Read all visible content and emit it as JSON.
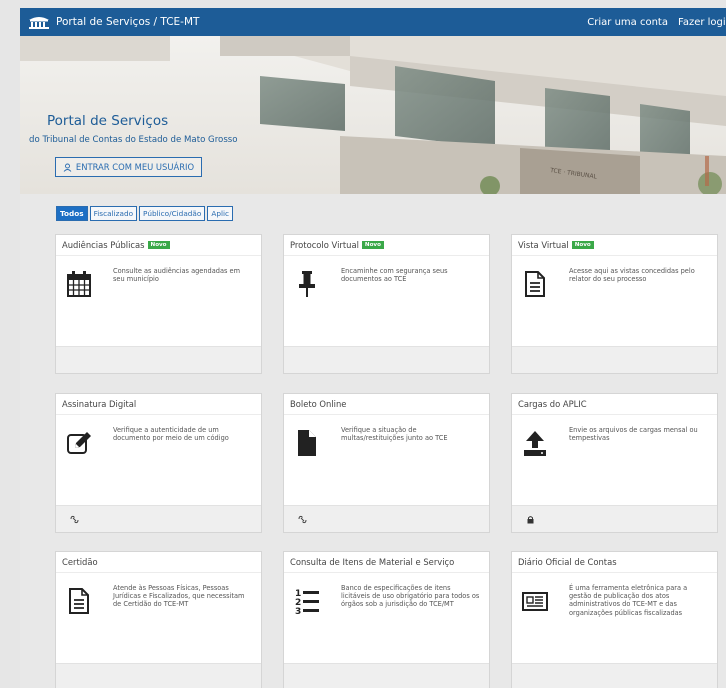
{
  "topbar": {
    "title": "Portal de Serviços / TCE-MT",
    "create_account": "Criar uma conta",
    "login": "Fazer login",
    "brand_color": "#1d5c97"
  },
  "hero": {
    "title": "Portal de Serviços",
    "subtitle": "do Tribunal de Contas do Estado de Mato Grosso",
    "login_button": "ENTRAR COM MEU USUÁRIO"
  },
  "tabs": [
    {
      "label": "Todos",
      "active": true
    },
    {
      "label": "Fiscalizado",
      "active": false
    },
    {
      "label": "Público/Cidadão",
      "active": false
    },
    {
      "label": "Aplic",
      "active": false
    }
  ],
  "badge_label": "Novo",
  "cards": [
    {
      "title": "Audiências Públicas",
      "badge": true,
      "icon": "calendar-icon",
      "desc": "Consulte as audiências agendadas em seu município",
      "footer_icon": ""
    },
    {
      "title": "Protocolo Virtual",
      "badge": true,
      "icon": "pushpin-icon",
      "desc": "Encaminhe com segurança seus documentos ao TCE",
      "footer_icon": ""
    },
    {
      "title": "Vista Virtual",
      "badge": true,
      "icon": "document-icon",
      "desc": "Acesse aqui as vistas concedidas pelo relator do seu processo",
      "footer_icon": ""
    },
    {
      "title": "Assinatura Digital",
      "badge": false,
      "icon": "edit-icon",
      "desc": "Verifique a autenticidade de um documento por meio de um código",
      "footer_icon": "link-icon"
    },
    {
      "title": "Boleto Online",
      "badge": false,
      "icon": "file-icon",
      "desc": "Verifique a situação de multas/restituições junto ao TCE",
      "footer_icon": "link-icon"
    },
    {
      "title": "Cargas do APLIC",
      "badge": false,
      "icon": "upload-icon",
      "desc": "Envie os arquivos de cargas mensal ou tempestivas",
      "footer_icon": "lock-icon"
    },
    {
      "title": "Certidão",
      "badge": false,
      "icon": "document-icon",
      "desc": "Atende às Pessoas Físicas, Pessoas Jurídicas e Fiscalizados, que necessitam de Certidão do TCE-MT",
      "footer_icon": ""
    },
    {
      "title": "Consulta de Itens de Material e Serviço",
      "badge": false,
      "icon": "numbered-list-icon",
      "desc": "Banco de especificações de itens licitáveis de uso obrigatório para todos os órgãos sob a jurisdição do TCE/MT",
      "footer_icon": ""
    },
    {
      "title": "Diário Oficial de Contas",
      "badge": false,
      "icon": "newspaper-icon",
      "desc": "É uma ferramenta eletrônica para a gestão de publicação dos atos administrativos do TCE-MT e das organizações públicas fiscalizadas",
      "footer_icon": ""
    }
  ]
}
